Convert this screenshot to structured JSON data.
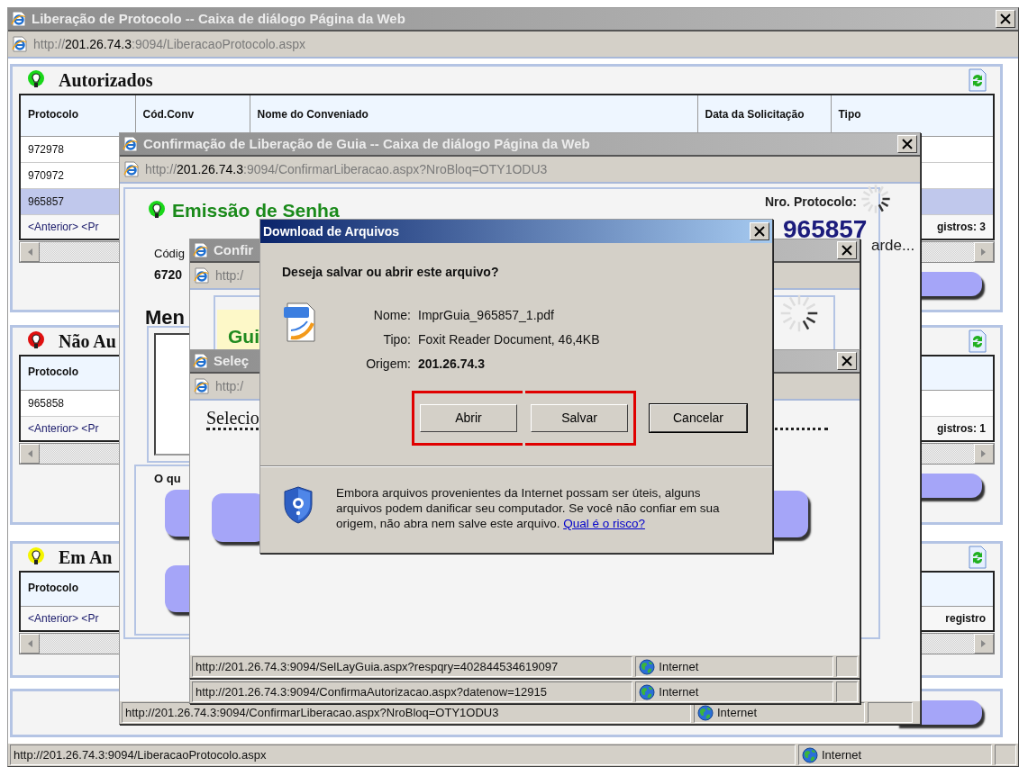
{
  "main_window": {
    "title": "Liberação de Protocolo -- Caixa de diálogo Página da Web",
    "address": {
      "prefix": "http://",
      "host": "201.26.74.3",
      "path": ":9094/LiberacaoProtocolo.aspx"
    },
    "panels": [
      {
        "title": "Autorizados",
        "color": "#19d719",
        "columns": [
          "Protocolo",
          "Cód.Conv",
          "Nome do Conveniado",
          "Data da Solicitação",
          "Tipo"
        ],
        "rows": [
          {
            "cells": [
              "972978"
            ],
            "selected": false
          },
          {
            "cells": [
              "970972"
            ],
            "selected": false
          },
          {
            "cells": [
              "965857"
            ],
            "selected": true
          }
        ],
        "pager": "<Anterior> <Pr",
        "count": "gistros: 3"
      },
      {
        "title": "Não Au",
        "color": "#e01010",
        "columns": [
          "Protocolo"
        ],
        "rows": [
          {
            "cells": [
              "965858"
            ],
            "selected": false
          }
        ],
        "pager": "<Anterior> <Pr",
        "count": "gistros: 1"
      },
      {
        "title": "Em An",
        "color": "#f5f500",
        "columns": [
          "Protocolo"
        ],
        "pager": "<Anterior> <Pr",
        "count": "registro"
      }
    ],
    "status_bar": {
      "url": "http://201.26.74.3:9094/LiberacaoProtocolo.aspx",
      "zone": "Internet"
    }
  },
  "confirm_window": {
    "title": "Confirmação de Liberação de Guia -- Caixa de diálogo Página da Web",
    "address": {
      "prefix": "http://",
      "host": "201.26.74.3",
      "path": ":9094/ConfirmarLiberacao.aspx?NroBloq=OTY1ODU3"
    },
    "heading": "Emissão de Senha",
    "protocol_label": "Nro. Protocolo:",
    "protocol_number": "965857",
    "wait_text": "arde...",
    "code_label": "Códig",
    "code_value": "6720",
    "message_label": "Men",
    "options_label": "O qu",
    "status_bar": {
      "url": "http://201.26.74.3:9094/ConfirmarLiberacao.aspx?NroBloq=OTY1ODU3",
      "zone": "Internet"
    }
  },
  "guide_window": {
    "title": "Confir",
    "address": {
      "prefix": "http:/"
    },
    "heading": "Gui",
    "status_bar": {
      "url": "http://201.26.74.3:9094/ConfirmaAutorizacao.aspx?datenow=12915",
      "zone": "Internet"
    }
  },
  "select_window": {
    "title": "Seleç",
    "address": {
      "prefix": "http:/"
    },
    "prompt": "Selecio",
    "status_bar": {
      "url": "http://201.26.74.3:9094/SelLayGuia.aspx?respqry=402844534619097",
      "zone": "Internet"
    }
  },
  "download_dialog": {
    "title": "Download de Arquivos",
    "question": "Deseja salvar ou abrir este arquivo?",
    "fields": [
      {
        "label": "Nome:",
        "value": "ImprGuia_965857_1.pdf",
        "bold": false
      },
      {
        "label": "Tipo:",
        "value": "Foxit Reader Document, 46,4KB",
        "bold": false
      },
      {
        "label": "Origem:",
        "value": "201.26.74.3",
        "bold": true
      }
    ],
    "buttons": [
      {
        "label": "Abrir",
        "highlighted": true,
        "default": false
      },
      {
        "label": "Salvar",
        "highlighted": true,
        "default": false
      },
      {
        "label": "Cancelar",
        "highlighted": false,
        "default": true
      }
    ],
    "warning": "Embora arquivos provenientes da Internet possam ser úteis, alguns arquivos podem danificar seu computador. Se você não confiar em sua origem, não abra nem salve este arquivo.",
    "risk_link": "Qual é o risco?"
  }
}
